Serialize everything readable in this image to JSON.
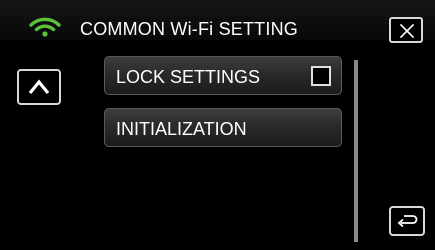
{
  "header": {
    "title": "COMMON Wi-Fi SETTING",
    "wifi_icon": "wifi-icon",
    "close_icon": "close-icon"
  },
  "navigation": {
    "up_icon": "chevron-up-icon",
    "back_icon": "return-arrow-icon"
  },
  "menu": {
    "items": [
      {
        "label": "LOCK SETTINGS",
        "checked": false
      },
      {
        "label": "INITIALIZATION"
      }
    ]
  },
  "colors": {
    "background": "#000000",
    "wifi_green": "#5cc23a",
    "button_border": "#d8d8d8"
  }
}
